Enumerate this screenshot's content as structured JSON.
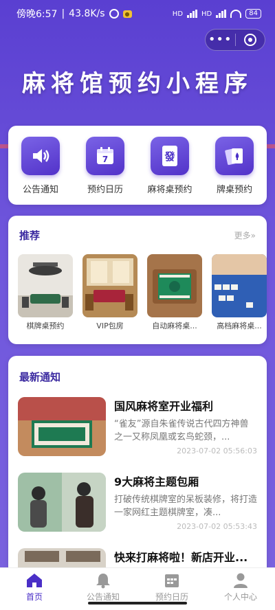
{
  "status": {
    "time": "傍晚6:57",
    "speed": "43.8K/s",
    "network1": "HD",
    "network2": "HD",
    "battery": "84"
  },
  "capsule": {
    "more": "•••"
  },
  "hero": {
    "title": "麻将馆预约小程序"
  },
  "quick": [
    {
      "label": "公告通知",
      "icon": "speaker-icon"
    },
    {
      "label": "预约日历",
      "icon": "calendar-icon",
      "number": "7"
    },
    {
      "label": "麻将桌预约",
      "icon": "mahjong-tile-icon",
      "glyph": "發"
    },
    {
      "label": "牌桌预约",
      "icon": "cards-icon"
    }
  ],
  "recommend": {
    "title": "推荐",
    "more": "更多»",
    "items": [
      {
        "name": "棋牌桌预约"
      },
      {
        "name": "VIP包房"
      },
      {
        "name": "自动麻将桌..."
      },
      {
        "name": "高档麻将桌..."
      }
    ]
  },
  "news": {
    "title": "最新通知",
    "items": [
      {
        "title": "国风麻将室开业福利",
        "desc": "“雀友”源自朱雀传说古代四方神兽之一又称凤凰或玄鸟蛇颈，...",
        "time": "2023-07-02 05:56:03"
      },
      {
        "title": "9大麻将主题包厢",
        "desc": "打破传统棋牌室的呆板装修，将打造一家网红主题棋牌室，凑...",
        "time": "2023-07-02 05:53:43"
      },
      {
        "title": "快来打麻将啦！新店开业...",
        "desc": "",
        "time": ""
      }
    ]
  },
  "tabbar": [
    {
      "label": "首页",
      "active": true
    },
    {
      "label": "公告通知"
    },
    {
      "label": "预约日历"
    },
    {
      "label": "个人中心"
    }
  ],
  "colors": {
    "brand": "#5232c9",
    "accent": "#4a2fc7"
  }
}
